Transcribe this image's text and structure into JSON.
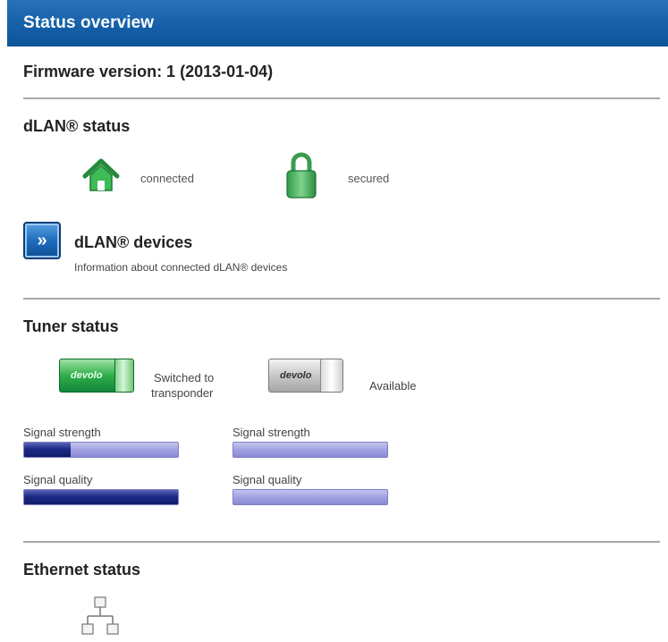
{
  "header": {
    "title": "Status overview"
  },
  "firmware": {
    "label": "Firmware version: 1 (2013-01-04)"
  },
  "dlan_status": {
    "title": "dLAN® status",
    "connection": {
      "icon": "house-icon",
      "label": "connected",
      "color": "#2ea845"
    },
    "security": {
      "icon": "lock-icon",
      "label": "secured",
      "color": "#2ea845"
    }
  },
  "dlan_devices": {
    "button_icon": "chevron-right-icon",
    "button_glyph": "»",
    "title": "dLAN® devices",
    "description": "Information about connected dLAN® devices"
  },
  "tuner_status": {
    "title": "Tuner status",
    "tuners": [
      {
        "state_label_line1": "Switched to",
        "state_label_line2": "transponder",
        "stick_color": "#2fae4a",
        "logo": "devolo",
        "signal_strength_label": "Signal strength",
        "signal_strength": 0.3,
        "signal_quality_label": "Signal quality",
        "signal_quality": 1.0
      },
      {
        "state_label": "Available",
        "stick_color": "#c8c8c8",
        "logo": "devolo",
        "signal_strength_label": "Signal strength",
        "signal_strength": 0.0,
        "signal_quality_label": "Signal quality",
        "signal_quality": 0.0
      }
    ]
  },
  "ethernet_status": {
    "title": "Ethernet status",
    "icon": "network-icon"
  },
  "colors": {
    "header_bg": "#1560a8",
    "bar_bg": "#9c9ce0",
    "bar_fill": "#1d2a86"
  }
}
